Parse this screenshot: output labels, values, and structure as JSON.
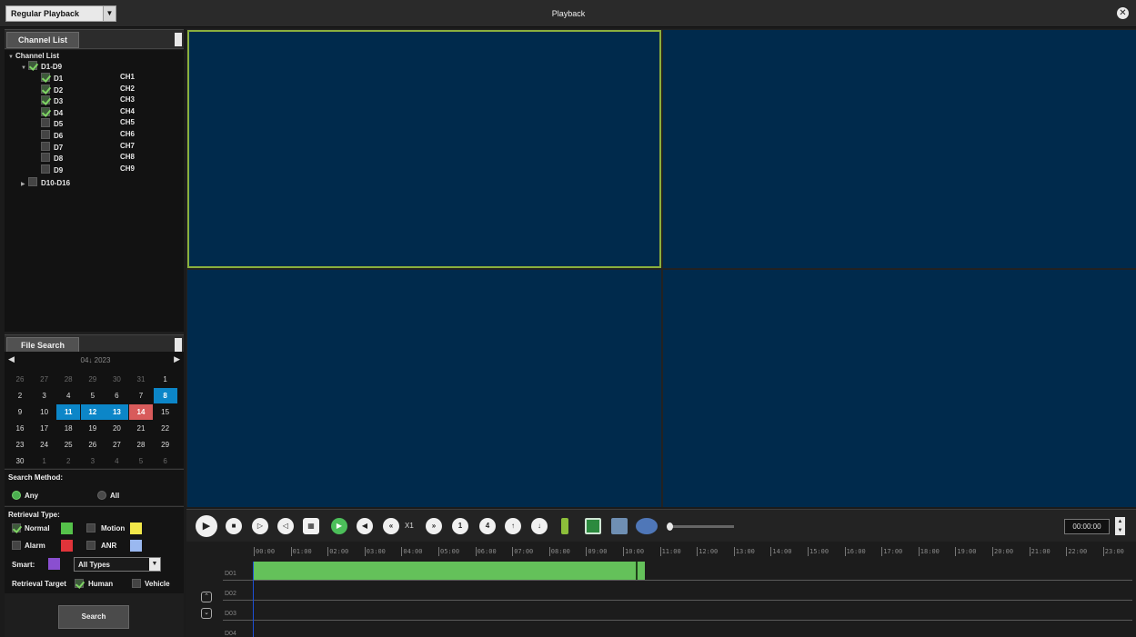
{
  "titlebar": {
    "mode": "Regular Playback",
    "title": "Playback"
  },
  "channel_panel": {
    "tab": "Channel List",
    "root": "Channel List",
    "group": "D1-D9",
    "channels": [
      {
        "id": "D1",
        "name": "CH1",
        "checked": true
      },
      {
        "id": "D2",
        "name": "CH2",
        "checked": true
      },
      {
        "id": "D3",
        "name": "CH3",
        "checked": true
      },
      {
        "id": "D4",
        "name": "CH4",
        "checked": true
      },
      {
        "id": "D5",
        "name": "CH5",
        "checked": false
      },
      {
        "id": "D6",
        "name": "CH6",
        "checked": false
      },
      {
        "id": "D7",
        "name": "CH7",
        "checked": false
      },
      {
        "id": "D8",
        "name": "CH8",
        "checked": false
      },
      {
        "id": "D9",
        "name": "CH9",
        "checked": false
      }
    ],
    "group2": "D10-D16"
  },
  "file_search": {
    "tab": "File Search",
    "month_year": "04↓ 2023",
    "days": [
      [
        "26",
        "27",
        "28",
        "29",
        "30",
        "31",
        "1"
      ],
      [
        "2",
        "3",
        "4",
        "5",
        "6",
        "7",
        "8"
      ],
      [
        "9",
        "10",
        "11",
        "12",
        "13",
        "14",
        "15"
      ],
      [
        "16",
        "17",
        "18",
        "19",
        "20",
        "21",
        "22"
      ],
      [
        "23",
        "24",
        "25",
        "26",
        "27",
        "28",
        "29"
      ],
      [
        "30",
        "1",
        "2",
        "3",
        "4",
        "5",
        "6"
      ]
    ]
  },
  "search_method": {
    "title": "Search Method:",
    "any": "Any",
    "all": "All"
  },
  "retrieval": {
    "title": "Retrieval Type:",
    "normal": "Normal",
    "motion": "Motion",
    "alarm": "Alarm",
    "anr": "ANR",
    "smart_label": "Smart:",
    "smart_value": "All Types",
    "target_label": "Retrieval Target",
    "human": "Human",
    "vehicle": "Vehicle",
    "colors": {
      "normal": "#55c24a",
      "motion": "#f2e84a",
      "alarm": "#e0343a",
      "anr": "#9ab8f0",
      "smart": "#8a4fd0"
    }
  },
  "search_button": "Search",
  "controls": {
    "speed": "X1",
    "time": "00:00:00"
  },
  "timeline": {
    "hours": [
      "00:00",
      "01:00",
      "02:00",
      "03:00",
      "04:00",
      "05:00",
      "06:00",
      "07:00",
      "08:00",
      "09:00",
      "10:00",
      "11:00",
      "12:00",
      "13:00",
      "14:00",
      "15:00",
      "16:00",
      "17:00",
      "18:00",
      "19:00",
      "20:00",
      "21:00",
      "22:00",
      "23:00"
    ],
    "tracks": [
      "D01",
      "D02",
      "D03",
      "D04"
    ]
  }
}
